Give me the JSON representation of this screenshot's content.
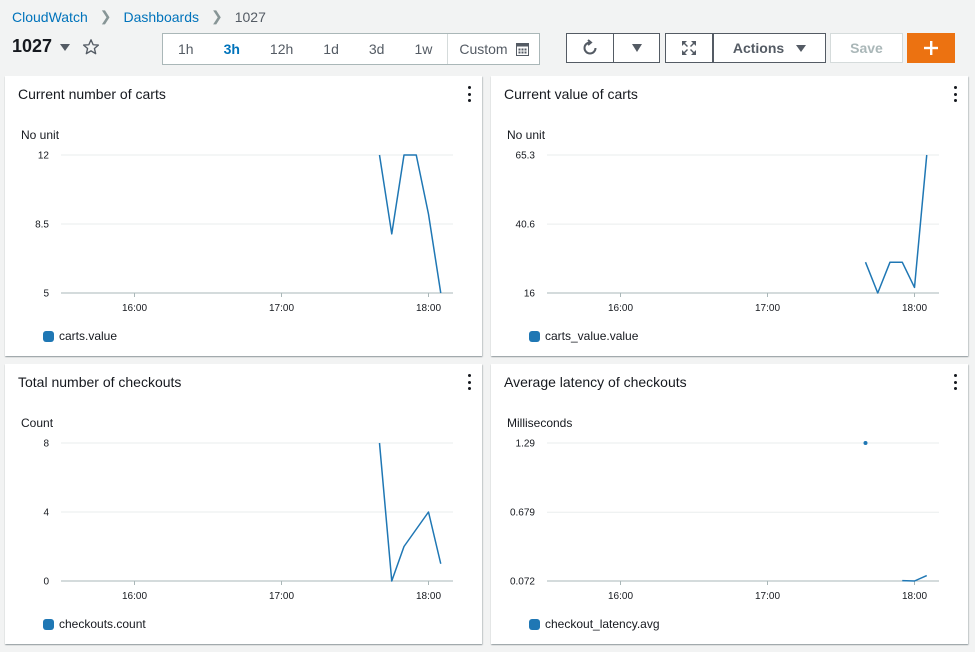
{
  "breadcrumb": {
    "root": "CloudWatch",
    "section": "Dashboards",
    "current": "1027"
  },
  "dashboard": {
    "title": "1027"
  },
  "time_ranges": [
    "1h",
    "3h",
    "12h",
    "1d",
    "3d",
    "1w"
  ],
  "time_active": "3h",
  "custom_label": "Custom",
  "toolbar": {
    "actions_label": "Actions",
    "save_label": "Save",
    "add_label": "+"
  },
  "colors": {
    "series": "#1f77b4",
    "accent": "#ec7211",
    "link": "#0073bb"
  },
  "icons": [
    "star-icon",
    "refresh-icon",
    "fullscreen-icon",
    "calendar-icon",
    "kebab-menu-icon",
    "plus-icon"
  ],
  "widgets": [
    {
      "title": "Current number of carts",
      "unit": "No unit",
      "legend": "carts.value",
      "chart_data": {
        "type": "line",
        "x_ticks": [
          "16:00",
          "17:00",
          "18:00"
        ],
        "y_ticks": [
          "5",
          "8.5",
          "12"
        ],
        "ylim": [
          5,
          12
        ],
        "series": [
          {
            "name": "carts.value",
            "x": [
              "17:40",
              "17:45",
              "17:50",
              "17:55",
              "18:00",
              "18:05"
            ],
            "y": [
              12,
              8,
              12,
              12,
              9,
              5
            ]
          }
        ]
      }
    },
    {
      "title": "Current value of carts",
      "unit": "No unit",
      "legend": "carts_value.value",
      "chart_data": {
        "type": "line",
        "x_ticks": [
          "16:00",
          "17:00",
          "18:00"
        ],
        "y_ticks": [
          "16",
          "40.6",
          "65.3"
        ],
        "ylim": [
          16,
          65.3
        ],
        "series": [
          {
            "name": "carts_value.value",
            "x": [
              "17:40",
              "17:45",
              "17:50",
              "17:55",
              "18:00",
              "18:05"
            ],
            "y": [
              27,
              16,
              27,
              27,
              18,
              65.3
            ]
          }
        ]
      }
    },
    {
      "title": "Total number of checkouts",
      "unit": "Count",
      "legend": "checkouts.count",
      "chart_data": {
        "type": "line",
        "x_ticks": [
          "16:00",
          "17:00",
          "18:00"
        ],
        "y_ticks": [
          "0",
          "4",
          "8"
        ],
        "ylim": [
          0,
          8
        ],
        "series": [
          {
            "name": "checkouts.count",
            "x": [
              "17:40",
              "17:45",
              "17:50",
              "17:55",
              "18:00",
              "18:05"
            ],
            "y": [
              8,
              0,
              2,
              3,
              4,
              1
            ]
          }
        ]
      }
    },
    {
      "title": "Average latency of checkouts",
      "unit": "Milliseconds",
      "legend": "checkout_latency.avg",
      "chart_data": {
        "type": "line",
        "x_ticks": [
          "16:00",
          "17:00",
          "18:00"
        ],
        "y_ticks": [
          "0.072",
          "0.679",
          "1.29"
        ],
        "ylim": [
          0.072,
          1.29
        ],
        "series": [
          {
            "name": "checkout_latency.avg",
            "x": [
              "17:40",
              "17:50",
              "17:55",
              "18:00",
              "18:05"
            ],
            "y": [
              1.29,
              null,
              0.075,
              0.072,
              0.12
            ]
          }
        ]
      }
    }
  ]
}
